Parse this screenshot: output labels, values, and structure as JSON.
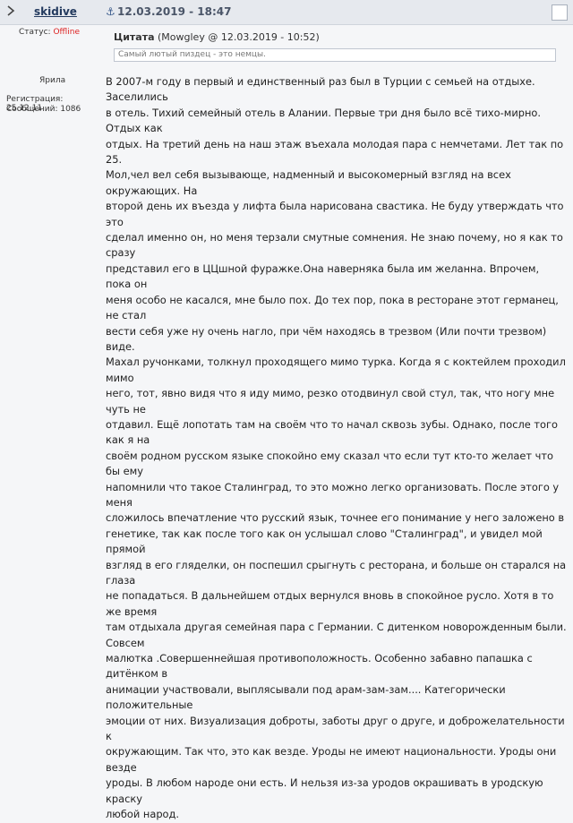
{
  "post": {
    "username": "skidive",
    "date": "12.03.2019 - 18:47",
    "number": "",
    "anchor_icon": "⚓"
  },
  "userinfo": {
    "status_label": "Статус:",
    "status_value": "Offline",
    "rank": "Ярила",
    "registration": "Регистрация: 25.12.11",
    "posts": "Сообщений: 1086"
  },
  "quote": {
    "label": "Цитата",
    "meta": " (Mowgley @ 12.03.2019 - 10:52)",
    "text": "Самый лютый пиздец - это немцы."
  },
  "body": "В 2007-м году в первый и единственный раз был в Турции с семьей на отдыхе. Заселились\nв отель. Тихий семейный отель в Алании. Первые три дня было всё тихо-мирно. Отдых как\nотдых. На третий день на наш этаж въехала молодая пара с немчетами. Лет так по 25.\nМол,чел вел себя вызывающе, надменный и высокомерный взгляд на всех окружающих. На\nвторой день их въезда у лифта была нарисована свастика. Не буду утверждать что это\nсделал именно он, но меня терзали смутные сомнения. Не знаю почему, но я как то сразу\nпредставил его в ЦЦшной фуражке.Она наверняка была им желанна. Впрочем, пока он\nменя особо не касался, мне было пох. До тех пор, пока в ресторане этот германец, не стал\nвести себя уже ну очень нагло, при чём находясь в трезвом (Или почти трезвом) виде.\nМахал ручонками, толкнул проходящего мимо турка. Когда я с коктейлем проходил мимо\nнего, тот, явно видя что я иду мимо, резко отодвинул свой стул, так, что ногу мне чуть не\nотдавил. Ещё лопотать там на своём что то начал сквозь зубы. Однако, после того как я на\nсвоём родном русском языке спокойно ему сказал что если тут кто-то желает что бы ему\nнапомнили что такое Сталинград, то это можно легко организовать. После этого у меня\nсложилось впечатление что русский язык, точнее его понимание у него заложено в\nгенетике, так как после того как он услышал слово \"Сталинград\", и увидел мой прямой\nвзгляд в его гляделки, он поспешил срыгнуть с ресторана, и больше он старался на глаза\nне попадаться. В дальнейшем отдых вернулся вновь в спокойное русло. Хотя в то же время\nтам отдыхала другая семейная пара с Германии. С дитенком новорожденным были. Совсем\nмалютка .Совершеннейшая противоположность. Особенно забавно папашка с дитёнком в\nанимации учаcтвовали, выплясывали под арам-зам-зам.... Категорически положительные\nэмоции от них. Визуализация доброты, заботы друг о друге, и доброжелательности к\nокружающим. Так что, это как везде. Уроды не имеют национальности. Уроды они везде\nуроды. В любом народе они есть. И нельзя из-за уродов окрашивать в уродскую краску\nлюбой народ."
}
